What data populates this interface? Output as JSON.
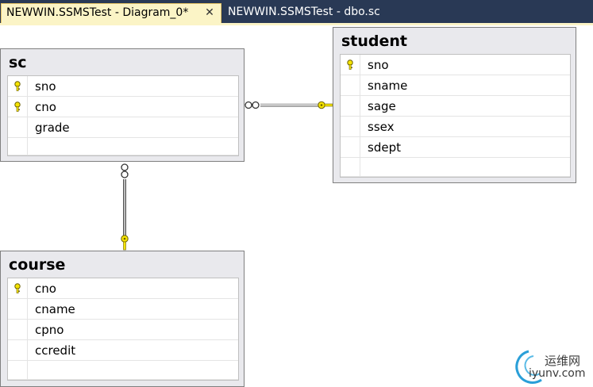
{
  "tabs": [
    {
      "label": "NEWWIN.SSMSTest - Diagram_0*",
      "close": "✕",
      "active": true
    },
    {
      "label": "NEWWIN.SSMSTest - dbo.sc",
      "active": false
    }
  ],
  "tables": {
    "sc": {
      "title": "sc",
      "columns": [
        {
          "name": "sno",
          "key": true
        },
        {
          "name": "cno",
          "key": true
        },
        {
          "name": "grade",
          "key": false
        }
      ]
    },
    "student": {
      "title": "student",
      "columns": [
        {
          "name": "sno",
          "key": true
        },
        {
          "name": "sname",
          "key": false
        },
        {
          "name": "sage",
          "key": false
        },
        {
          "name": "ssex",
          "key": false
        },
        {
          "name": "sdept",
          "key": false
        }
      ]
    },
    "course": {
      "title": "course",
      "columns": [
        {
          "name": "cno",
          "key": true
        },
        {
          "name": "cname",
          "key": false
        },
        {
          "name": "cpno",
          "key": false
        },
        {
          "name": "ccredit",
          "key": false
        }
      ]
    }
  },
  "relationships": [
    {
      "from": "sc",
      "to": "student",
      "many_end": "infinity-icon",
      "one_end": "key-icon"
    },
    {
      "from": "sc",
      "to": "course",
      "many_end": "infinity-icon",
      "one_end": "key-icon"
    }
  ],
  "watermark": {
    "cn": "运维网",
    "en": "iyunv.com"
  },
  "colors": {
    "tabstrip": "#293955",
    "active_tab": "#fbf4c6",
    "table_bg": "#e9e9ed",
    "key": "#f5e400"
  }
}
